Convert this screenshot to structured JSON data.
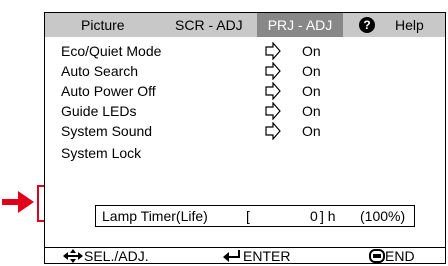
{
  "tabs": [
    {
      "label": "Picture",
      "active": false
    },
    {
      "label": "SCR - ADJ",
      "active": false
    },
    {
      "label": "PRJ - ADJ",
      "active": true
    },
    {
      "label": "Help",
      "active": false
    }
  ],
  "help_icon_glyph": "?",
  "menu": [
    {
      "label": "Eco/Quiet Mode",
      "value": "On"
    },
    {
      "label": "Auto Search",
      "value": "On"
    },
    {
      "label": "Auto Power Off",
      "value": "On"
    },
    {
      "label": "Guide LEDs",
      "value": "On"
    },
    {
      "label": "System Sound",
      "value": "On"
    },
    {
      "label": "System Lock",
      "value": ""
    }
  ],
  "lamp_timer": {
    "label": "Lamp Timer(Life)",
    "open_bracket": "[",
    "hours": "0",
    "close_unit": "] h",
    "percent": "(100%)"
  },
  "footer": {
    "select": "SEL./ADJ.",
    "enter": "ENTER",
    "end": "END"
  },
  "colors": {
    "highlight": "#e0001b",
    "tab_bar": "#c8c8c8",
    "active_tab": "#888888"
  }
}
